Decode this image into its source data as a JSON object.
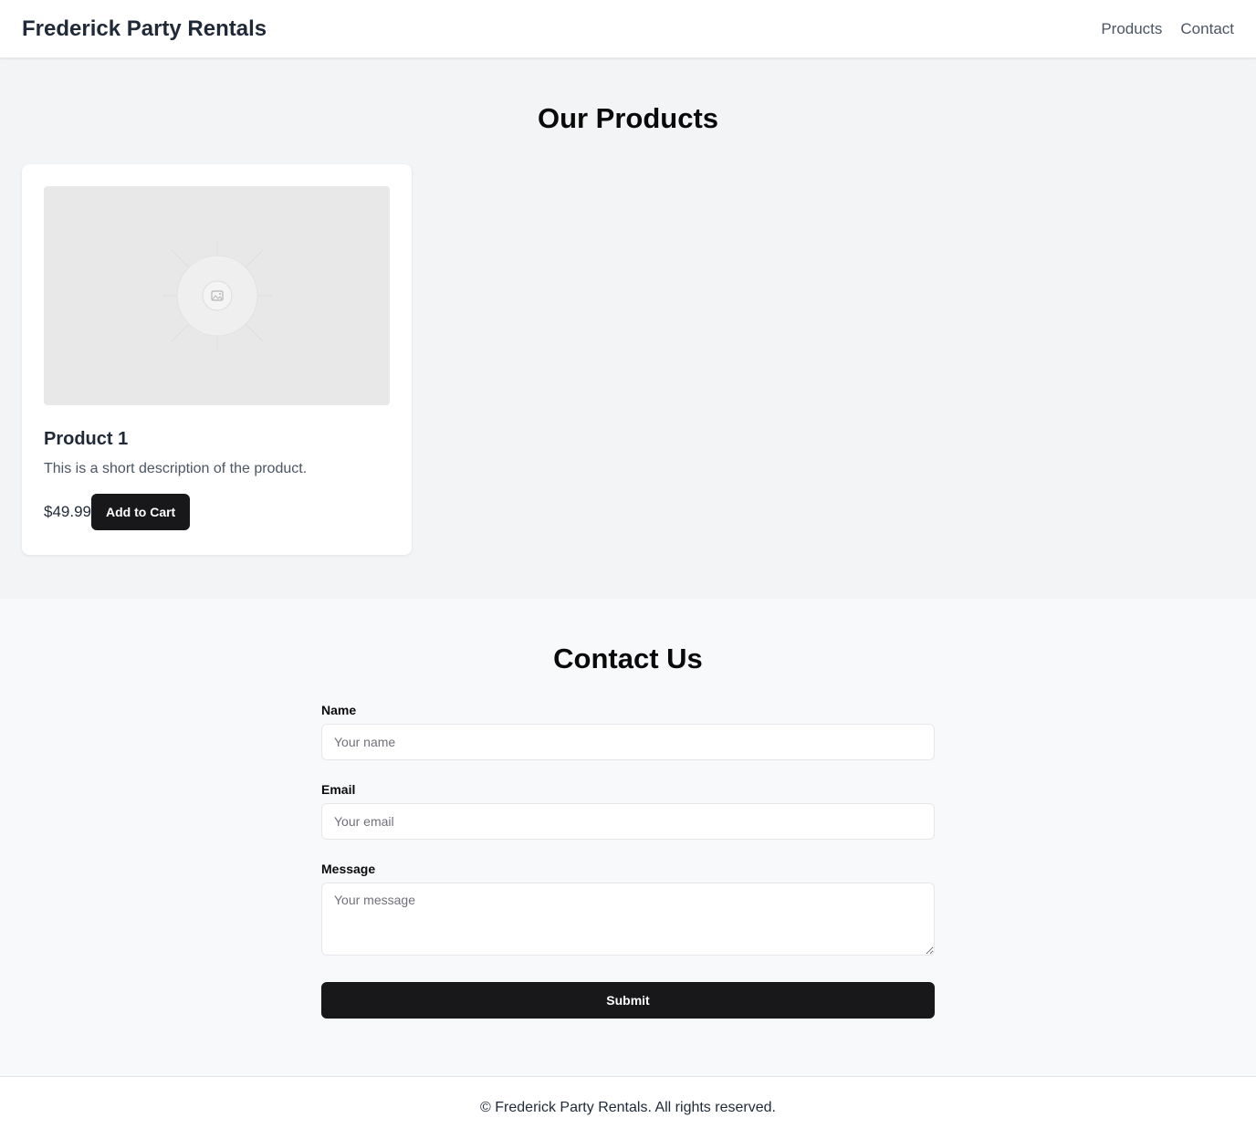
{
  "header": {
    "brand": "Frederick Party Rentals",
    "nav": [
      "Products",
      "Contact"
    ]
  },
  "products": {
    "title": "Our Products",
    "items": [
      {
        "name": "Product 1",
        "description": "This is a short description of the product.",
        "price": "$49.99",
        "button": "Add to Cart",
        "image_icon": "image-placeholder-icon"
      }
    ]
  },
  "contact": {
    "title": "Contact Us",
    "fields": {
      "name": {
        "label": "Name",
        "placeholder": "Your name"
      },
      "email": {
        "label": "Email",
        "placeholder": "Your email"
      },
      "message": {
        "label": "Message",
        "placeholder": "Your message"
      }
    },
    "submit": "Submit"
  },
  "footer": {
    "text": "© Frederick Party Rentals. All rights reserved."
  },
  "colors": {
    "primary_button": "#18181b",
    "products_bg": "#f3f4f6",
    "contact_bg": "#f8f9fb"
  }
}
